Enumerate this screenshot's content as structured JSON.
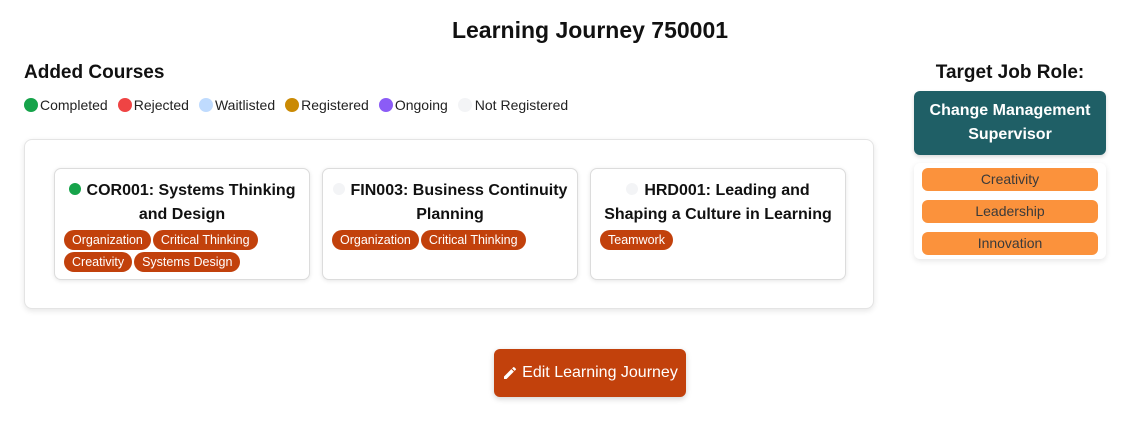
{
  "page": {
    "title": "Learning Journey 750001"
  },
  "courses_section": {
    "title": "Added Courses"
  },
  "legend": [
    {
      "label": "Completed",
      "color": "#16a34a"
    },
    {
      "label": "Rejected",
      "color": "#ef4444"
    },
    {
      "label": "Waitlisted",
      "color": "#bfdbfe"
    },
    {
      "label": "Registered",
      "color": "#ca8a04"
    },
    {
      "label": "Ongoing",
      "color": "#8b5cf6"
    },
    {
      "label": "Not Registered",
      "color": "#f3f4f6"
    }
  ],
  "courses": [
    {
      "title": "COR001: Systems Thinking and Design",
      "status_color": "#16a34a",
      "tags": [
        "Organization",
        "Critical Thinking",
        "Creativity",
        "Systems Design"
      ]
    },
    {
      "title": "FIN003: Business Continuity Planning",
      "status_color": "#f3f4f6",
      "tags": [
        "Organization",
        "Critical Thinking"
      ]
    },
    {
      "title": "HRD001: Leading and Shaping a Culture in Learning",
      "status_color": "#f3f4f6",
      "tags": [
        "Teamwork"
      ]
    }
  ],
  "target_role": {
    "heading": "Target Job Role:",
    "name": "Change Management Supervisor",
    "skills": [
      "Creativity",
      "Leadership",
      "Innovation"
    ]
  },
  "actions": {
    "edit_label": "Edit Learning Journey",
    "edit_icon": "pencil-icon"
  },
  "colors": {
    "accent": "#c2410c",
    "role": "#1f5f66",
    "skill": "#fb923c"
  }
}
